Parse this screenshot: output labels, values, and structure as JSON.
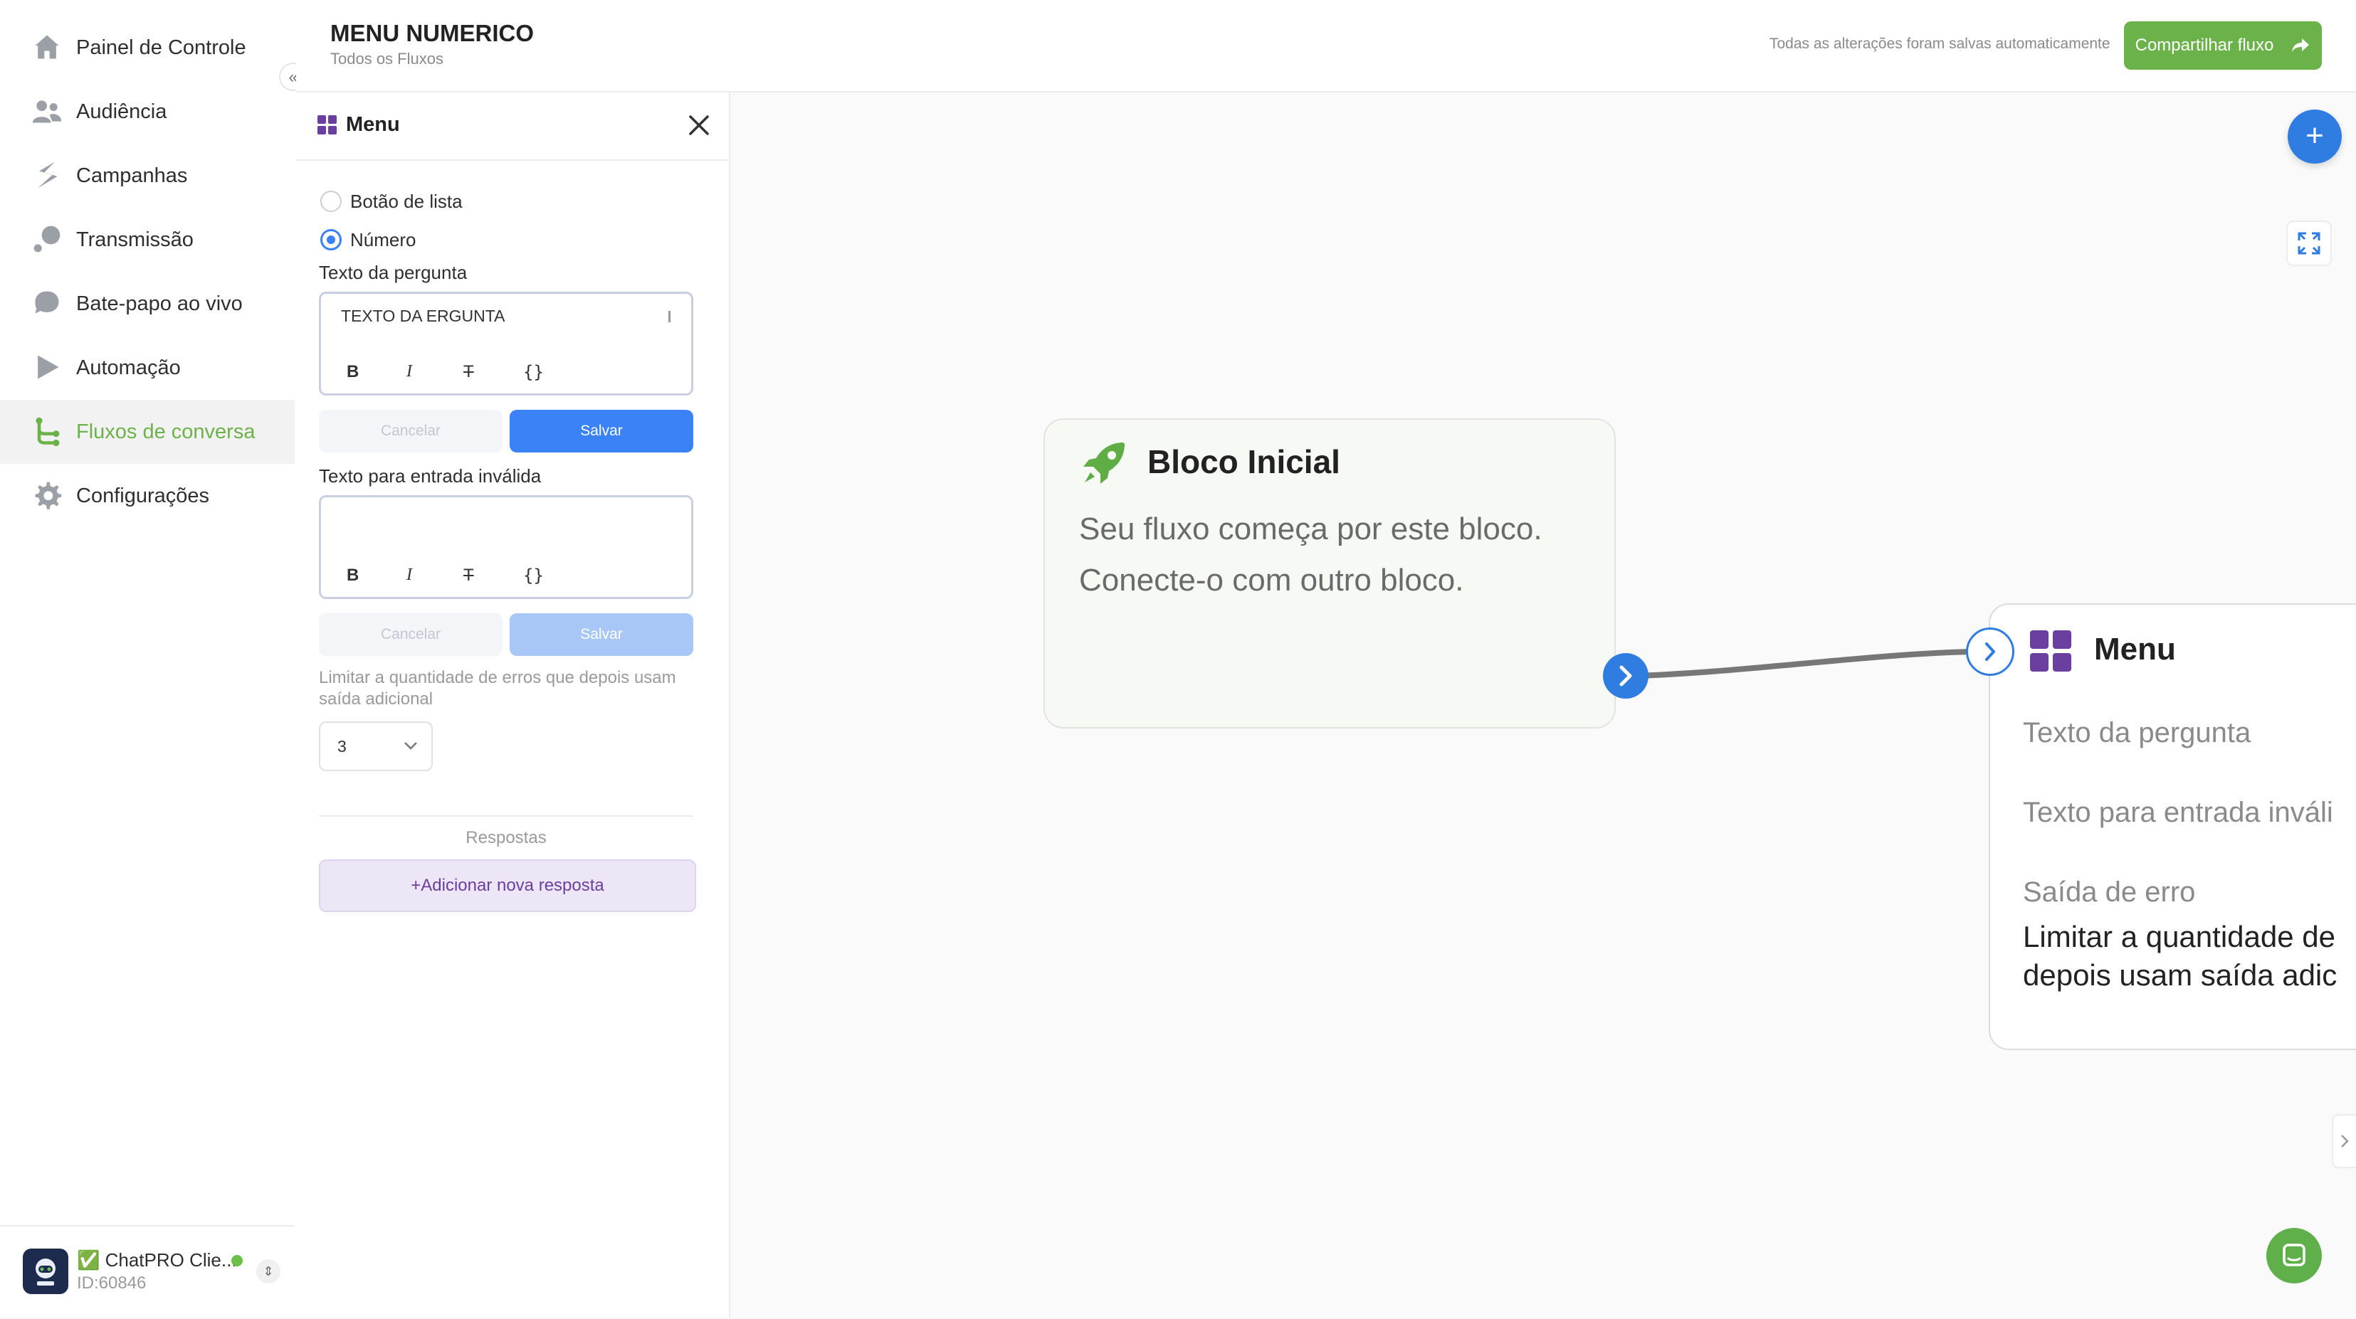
{
  "sidebar": {
    "collapse_icon": "double-chevron-left-icon",
    "items": [
      {
        "label": "Painel de Controle",
        "icon": "home-icon"
      },
      {
        "label": "Audiência",
        "icon": "users-icon"
      },
      {
        "label": "Campanhas",
        "icon": "campaign-icon"
      },
      {
        "label": "Transmissão",
        "icon": "broadcast-icon"
      },
      {
        "label": "Bate-papo ao vivo",
        "icon": "chat-bubble-icon"
      },
      {
        "label": "Automação",
        "icon": "play-icon"
      },
      {
        "label": "Fluxos de conversa",
        "icon": "flow-icon",
        "active": true
      },
      {
        "label": "Configurações",
        "icon": "gear-icon"
      }
    ],
    "account": {
      "name": "✅ ChatPRO Clie...",
      "id": "ID:60846",
      "status": "online"
    }
  },
  "header": {
    "title": "MENU NUMERICO",
    "breadcrumb": "Todos os Fluxos",
    "autosave": "Todas as alterações foram salvas automaticamente",
    "share_label": "Compartilhar fluxo"
  },
  "panel": {
    "title": "Menu",
    "options": [
      {
        "label": "Botão de lista",
        "checked": false
      },
      {
        "label": "Número",
        "checked": true
      }
    ],
    "question_label": "Texto da pergunta",
    "question_value": "TEXTO DA ERGUNTA",
    "invalid_label": "Texto para entrada inválida",
    "invalid_value": "",
    "toolbar": {
      "bold": "B",
      "italic": "I",
      "strike": "T",
      "vars": "{}"
    },
    "cancel_label": "Cancelar",
    "save_label": "Salvar",
    "limit_label": "Limitar a quantidade de erros que depois usam saída adicional",
    "limit_value": "3",
    "answers_label": "Respostas",
    "add_answer_label": "+Adicionar nova resposta"
  },
  "canvas": {
    "start_node": {
      "title": "Bloco Inicial",
      "line1": "Seu fluxo começa por este bloco.",
      "line2": "Conecte-o com outro bloco."
    },
    "menu_node": {
      "title": "Menu",
      "question": "Texto da pergunta",
      "invalid": "Texto para entrada inváli",
      "error_exit": "Saída de erro",
      "error_desc_line1": "Limitar a quantidade de",
      "error_desc_line2": "depois usam saída adic"
    }
  },
  "colors": {
    "accent_green": "#6cb24a",
    "accent_blue": "#3b82f6",
    "menu_purple": "#6b3fa0"
  }
}
